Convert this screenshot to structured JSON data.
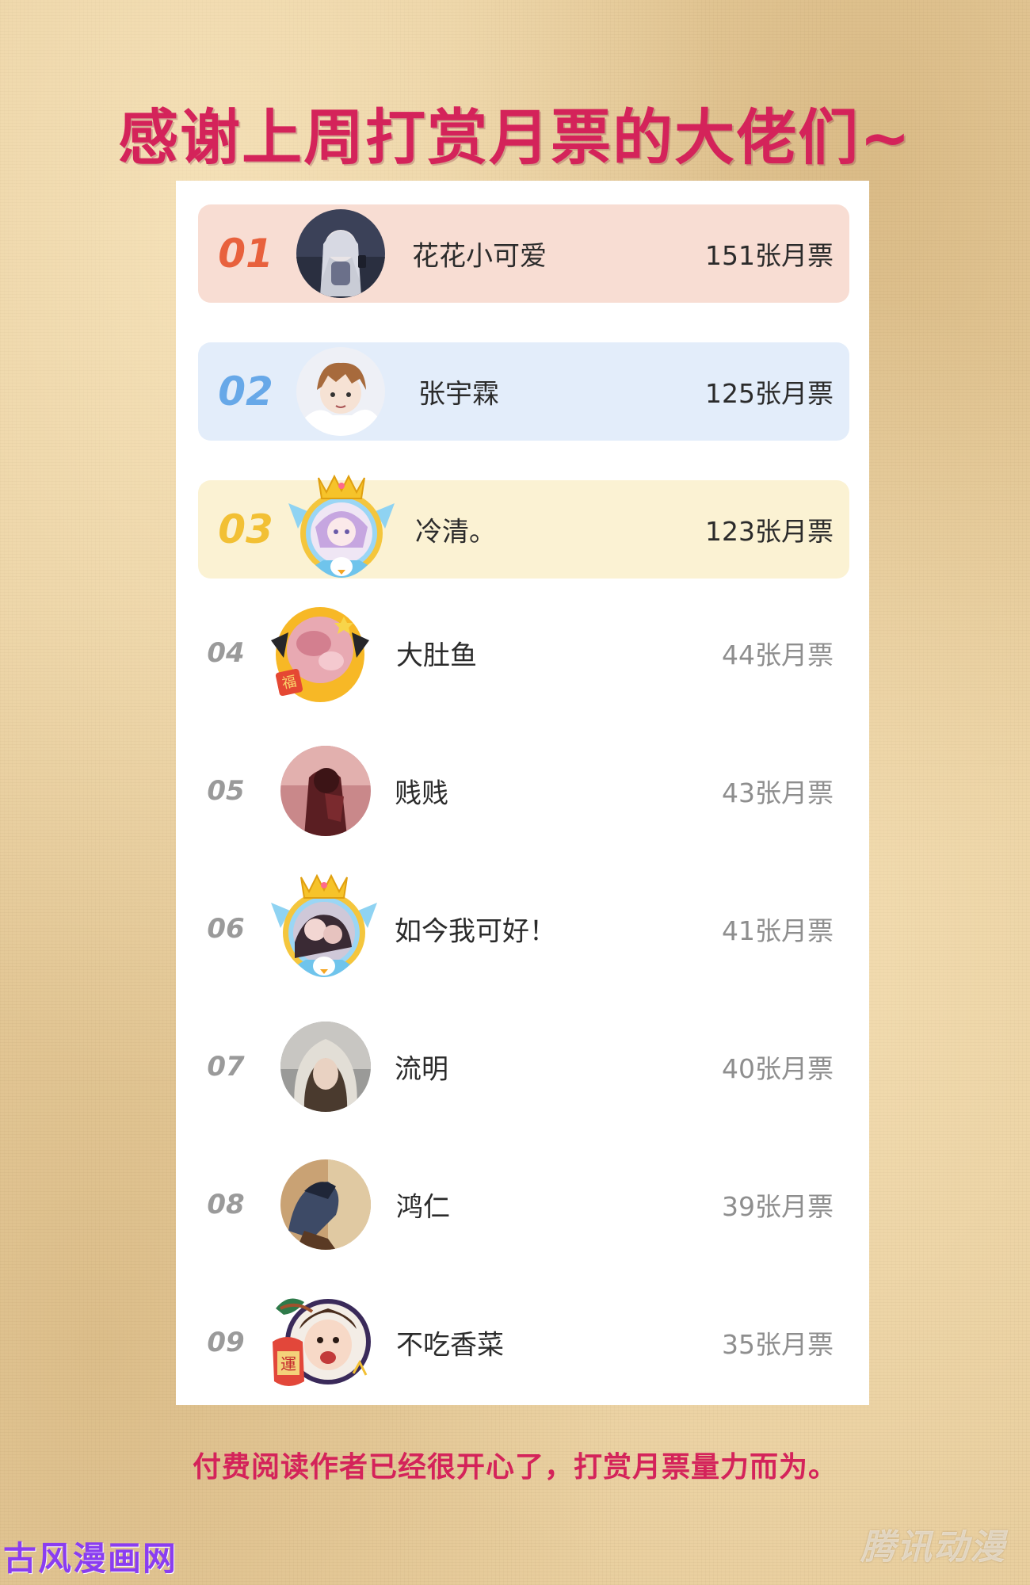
{
  "title": "感谢上周打赏月票的大佬们~",
  "colors": {
    "title": "#d4235a",
    "rank1_bg": "#f8ddd3",
    "rank2_bg": "#e3edfa",
    "rank3_bg": "#fbf2d3",
    "rank1_num": "#e8613d",
    "rank2_num": "#67a8e8",
    "rank3_num": "#f2c034"
  },
  "leaderboard": [
    {
      "rank": "01",
      "name": "花花小可爱",
      "votes": "151张月票",
      "avatar_icon": "anime-girl-avatar-icon"
    },
    {
      "rank": "02",
      "name": "张宇霖",
      "votes": "125张月票",
      "avatar_icon": "anime-boy-avatar-icon"
    },
    {
      "rank": "03",
      "name": "冷清。",
      "votes": "123张月票",
      "avatar_icon": "crowned-anime-avatar-icon"
    },
    {
      "rank": "04",
      "name": "大肚鱼",
      "votes": "44张月票",
      "avatar_icon": "fortune-egg-avatar-icon"
    },
    {
      "rank": "05",
      "name": "贱贱",
      "votes": "43张月票",
      "avatar_icon": "couple-photo-avatar-icon"
    },
    {
      "rank": "06",
      "name": "如今我可好！",
      "votes": "41张月票",
      "avatar_icon": "crowned-couple-avatar-icon"
    },
    {
      "rank": "07",
      "name": "流明",
      "votes": "40张月票",
      "avatar_icon": "fur-hood-avatar-icon"
    },
    {
      "rank": "08",
      "name": "鸿仁",
      "votes": "39张月票",
      "avatar_icon": "bird-photo-avatar-icon"
    },
    {
      "rank": "09",
      "name": "不吃香菜",
      "votes": "35张月票",
      "avatar_icon": "lucky-child-avatar-icon"
    }
  ],
  "footer": "付费阅读作者已经很开心了，打赏月票量力而为。",
  "watermarks": {
    "left": "古风漫画网",
    "right": "腾讯动漫"
  }
}
